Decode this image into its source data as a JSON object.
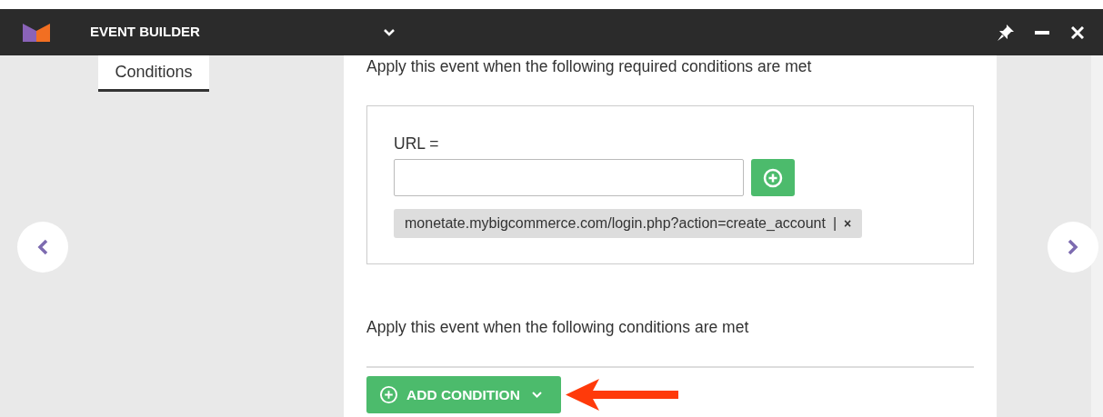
{
  "header": {
    "title": "EVENT BUILDER"
  },
  "tabs": [
    {
      "label": "Conditions",
      "selected": true
    }
  ],
  "required_section": {
    "heading": "Apply this event when the following required conditions are met",
    "condition": {
      "label": "URL =",
      "chips": [
        {
          "text": "monetate.mybigcommerce.com/login.php?action=create_account",
          "separator": "|",
          "remove": "×"
        }
      ]
    }
  },
  "optional_section": {
    "heading": "Apply this event when the following conditions are met",
    "button": "ADD CONDITION"
  }
}
